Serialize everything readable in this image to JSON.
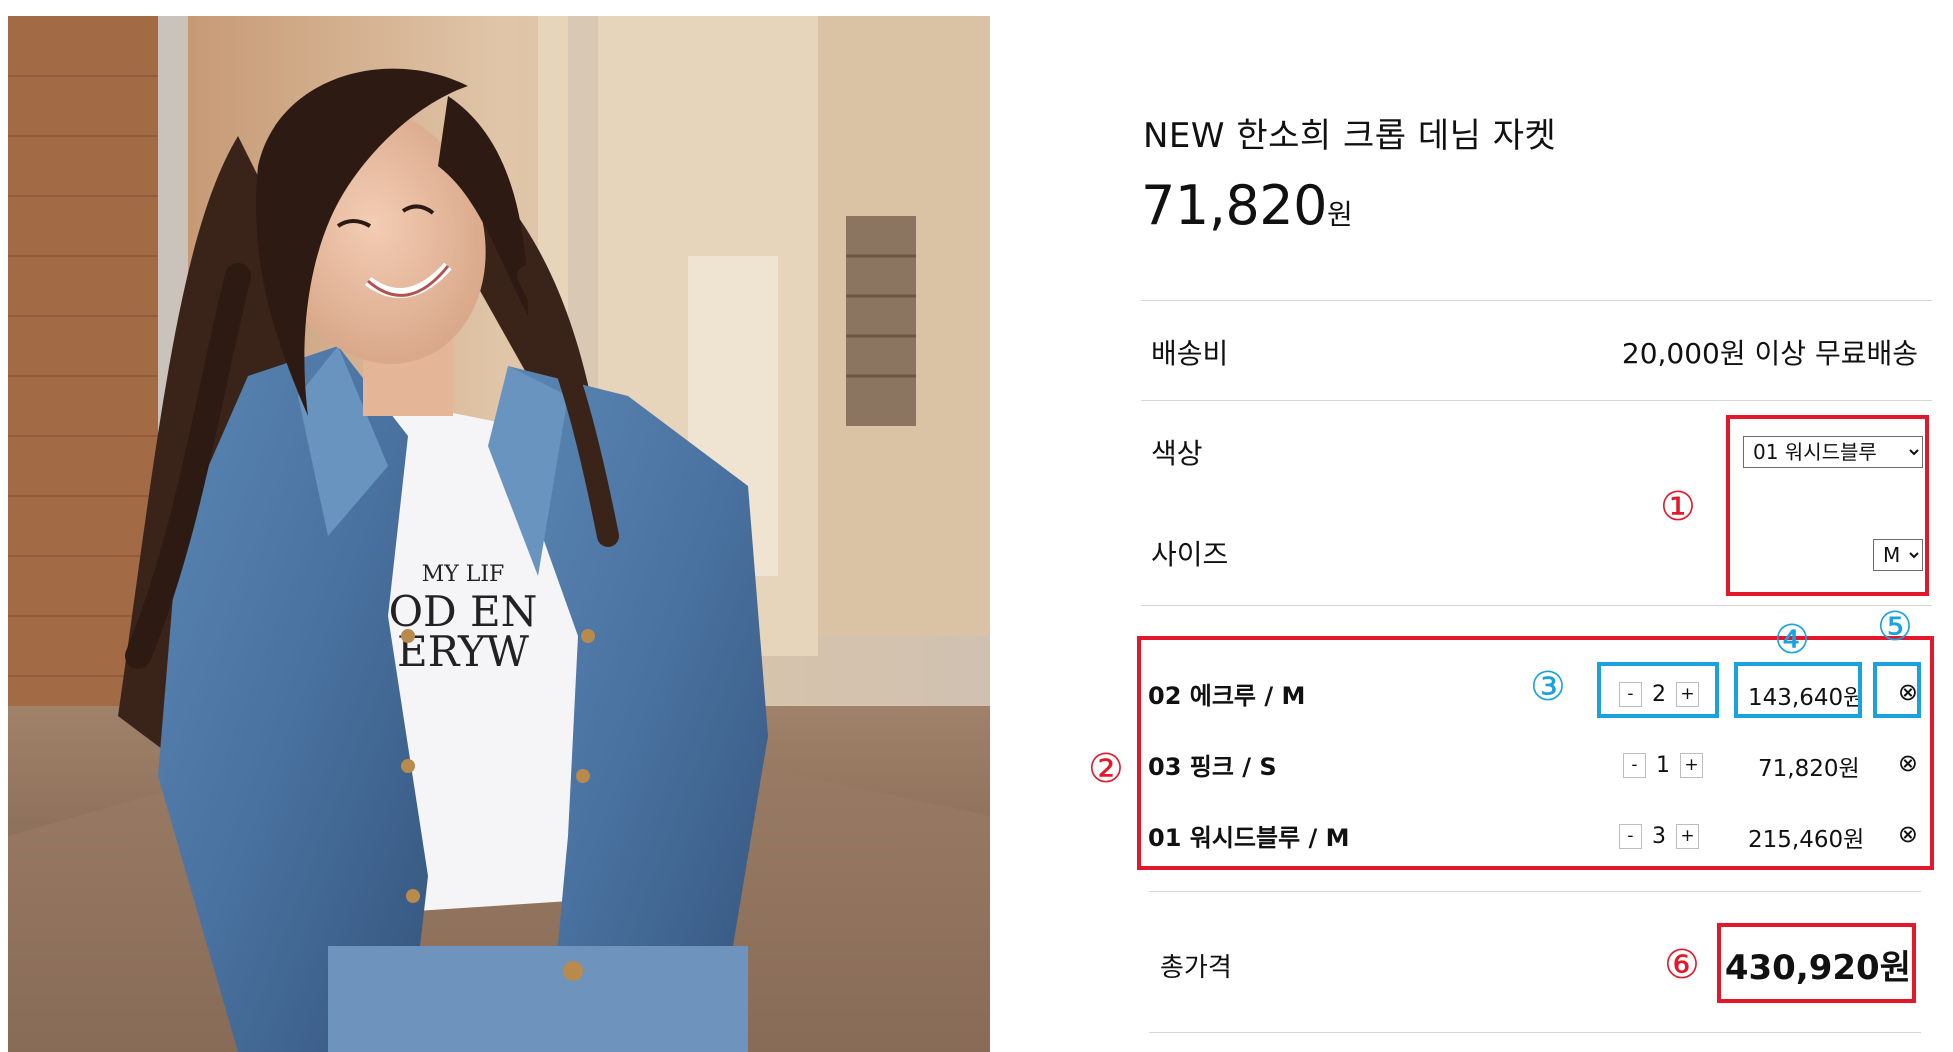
{
  "product": {
    "title": "NEW 한소희 크롭 데님 자켓",
    "price_number": "71,820",
    "price_unit": "원",
    "photo_print_text": [
      "MY LIF",
      "OD EN",
      "ERYW"
    ]
  },
  "shipping": {
    "label": "배송비",
    "value": "20,000원 이상 무료배송"
  },
  "options": {
    "color_label": "색상",
    "color_selected": "01 워시드블루",
    "size_label": "사이즈",
    "size_selected": "M"
  },
  "selected_items": [
    {
      "name": "02 에크루 / M",
      "qty": "2",
      "amount": "143,640원",
      "minus": "-",
      "plus": "+",
      "remove_icon": "⊗"
    },
    {
      "name": "03 핑크 / S",
      "qty": "1",
      "amount": "71,820원",
      "minus": "-",
      "plus": "+",
      "remove_icon": "⊗"
    },
    {
      "name": "01 워시드블루 / M",
      "qty": "3",
      "amount": "215,460원",
      "minus": "-",
      "plus": "+",
      "remove_icon": "⊗"
    }
  ],
  "total": {
    "label": "총가격",
    "value": "430,920원"
  },
  "annotations": {
    "m1": "①",
    "m2": "②",
    "m3": "③",
    "m4": "④",
    "m5": "⑤",
    "m6": "⑥"
  },
  "colors": {
    "annotation_red": "#e3192b",
    "annotation_blue": "#1aa2e0"
  }
}
